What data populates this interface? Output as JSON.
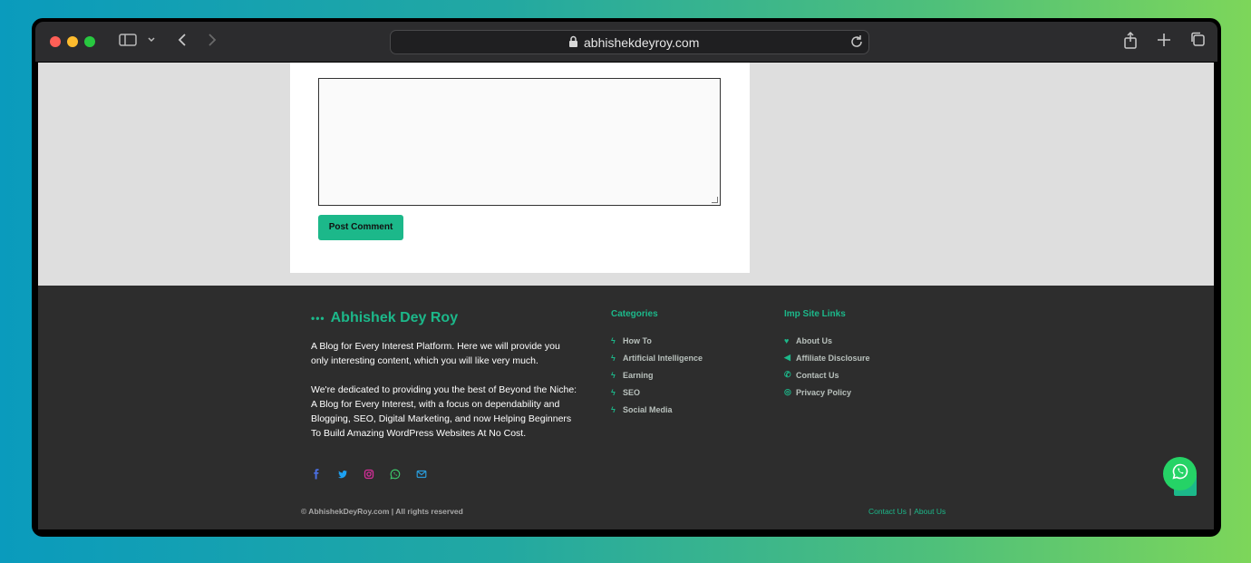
{
  "browser": {
    "url": "abhishekdeyroy.com"
  },
  "comment_form": {
    "post_button_label": "Post Comment"
  },
  "footer": {
    "brand_dots": "•••",
    "brand": "Abhishek Dey Roy",
    "about_p1": "A Blog for Every Interest Platform. Here we will provide you only interesting content, which you will like very much.",
    "about_p2": "We're dedicated to providing you the best of Beyond the Niche: A Blog for Every Interest, with a focus on dependability and Blogging, SEO, Digital Marketing, and now Helping Beginners To Build Amazing WordPress Websites At No Cost.",
    "social_icons": [
      "facebook-icon",
      "twitter-icon",
      "instagram-icon",
      "whatsapp-icon",
      "email-icon"
    ],
    "categories_title": "Categories",
    "categories": [
      {
        "label": "How To",
        "icon": "bolt-icon"
      },
      {
        "label": "Artificial Intelligence",
        "icon": "bolt-icon"
      },
      {
        "label": "Earning",
        "icon": "bolt-icon"
      },
      {
        "label": "SEO",
        "icon": "bolt-icon"
      },
      {
        "label": "Social Media",
        "icon": "bolt-icon"
      }
    ],
    "imp_title": "Imp Site Links",
    "imp_links": [
      {
        "label": "About Us",
        "icon": "heart-icon"
      },
      {
        "label": "Affiliate Disclosure",
        "icon": "megaphone-icon"
      },
      {
        "label": "Contact Us",
        "icon": "phone-icon"
      },
      {
        "label": "Privacy Policy",
        "icon": "target-icon"
      }
    ],
    "copyright": "© AbhishekDeyRoy.com | All rights reserved",
    "bottom_contact": "Contact Us",
    "bottom_sep": "|",
    "bottom_about": "About Us"
  },
  "colors": {
    "accent": "#1cb88a",
    "footer_bg": "#2d2d2d",
    "page_bg": "#dedede",
    "whatsapp": "#25d366"
  }
}
